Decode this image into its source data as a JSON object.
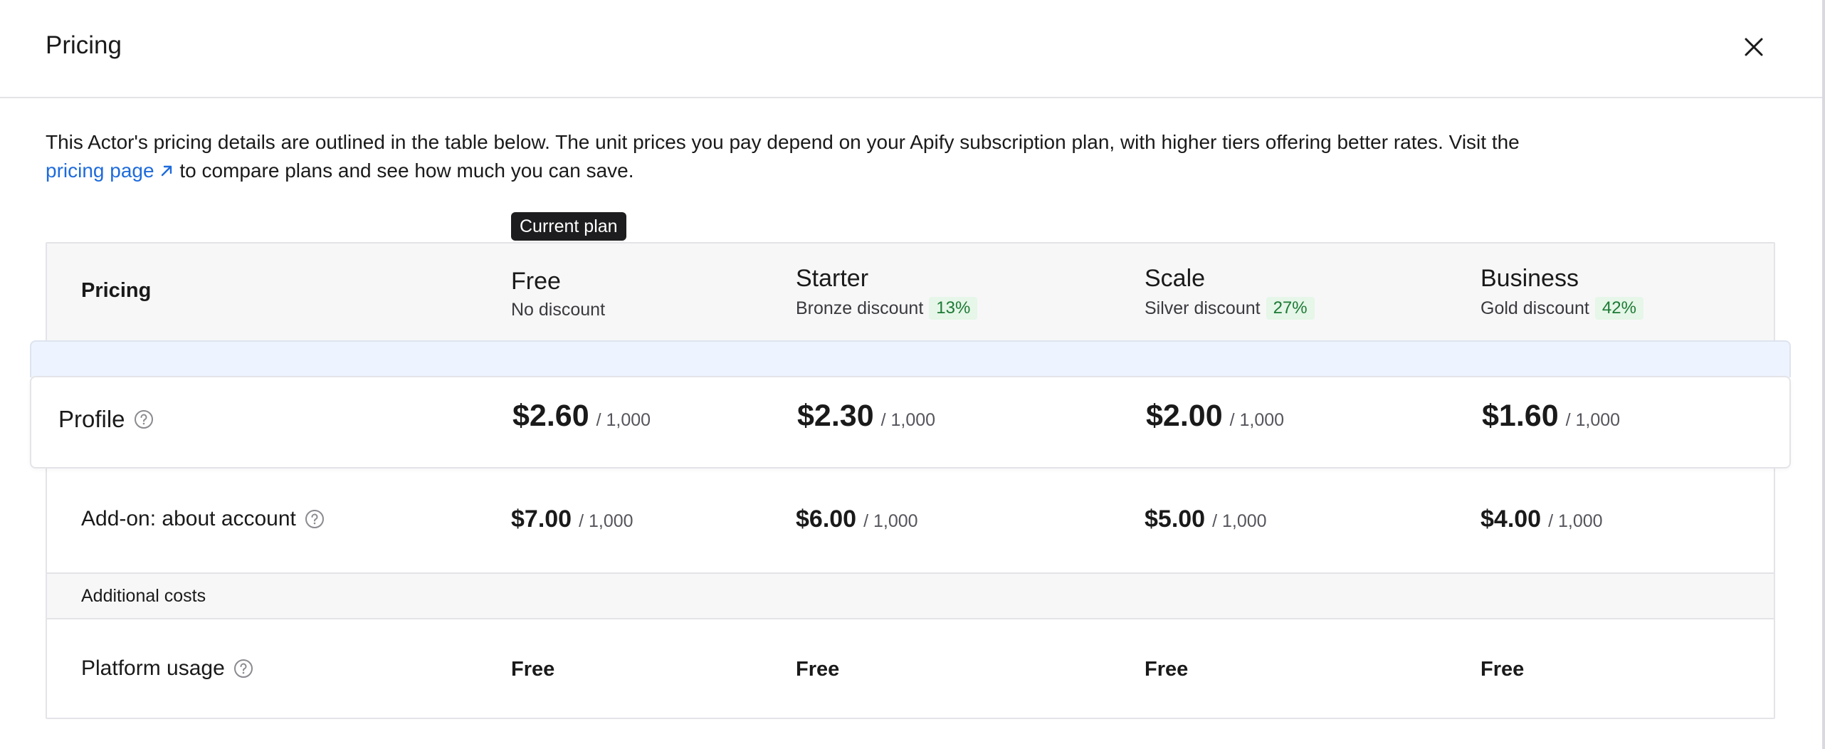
{
  "header": {
    "title": "Pricing"
  },
  "description": {
    "text_before": "This Actor's pricing details are outlined in the table below. The unit prices you pay depend on your Apify subscription plan, with higher tiers offering better rates. Visit the",
    "link_label": "pricing page",
    "text_after": "to compare plans and see how much you can save."
  },
  "table": {
    "current_plan_badge": "Current plan",
    "header_label": "Pricing",
    "plans": [
      {
        "name": "Free",
        "discount_label": "No discount",
        "discount_pct": ""
      },
      {
        "name": "Starter",
        "discount_label": "Bronze discount",
        "discount_pct": "13%"
      },
      {
        "name": "Scale",
        "discount_label": "Silver discount",
        "discount_pct": "27%"
      },
      {
        "name": "Business",
        "discount_label": "Gold discount",
        "discount_pct": "42%"
      }
    ],
    "rows": [
      {
        "label": "Profile",
        "unit": "/ 1,000",
        "prices": [
          "$2.60",
          "$2.30",
          "$2.00",
          "$1.60"
        ]
      },
      {
        "label": "Add-on: about account",
        "unit": "/ 1,000",
        "prices": [
          "$7.00",
          "$6.00",
          "$5.00",
          "$4.00"
        ]
      }
    ],
    "additional_costs": {
      "section_label": "Additional costs",
      "label": "Platform usage",
      "values": [
        "Free",
        "Free",
        "Free",
        "Free"
      ]
    }
  },
  "colors": {
    "link": "#1e6bdc",
    "discount_bg": "#e6f6e8",
    "discount_text": "#1c7a35",
    "highlight": "#eef4ff"
  }
}
